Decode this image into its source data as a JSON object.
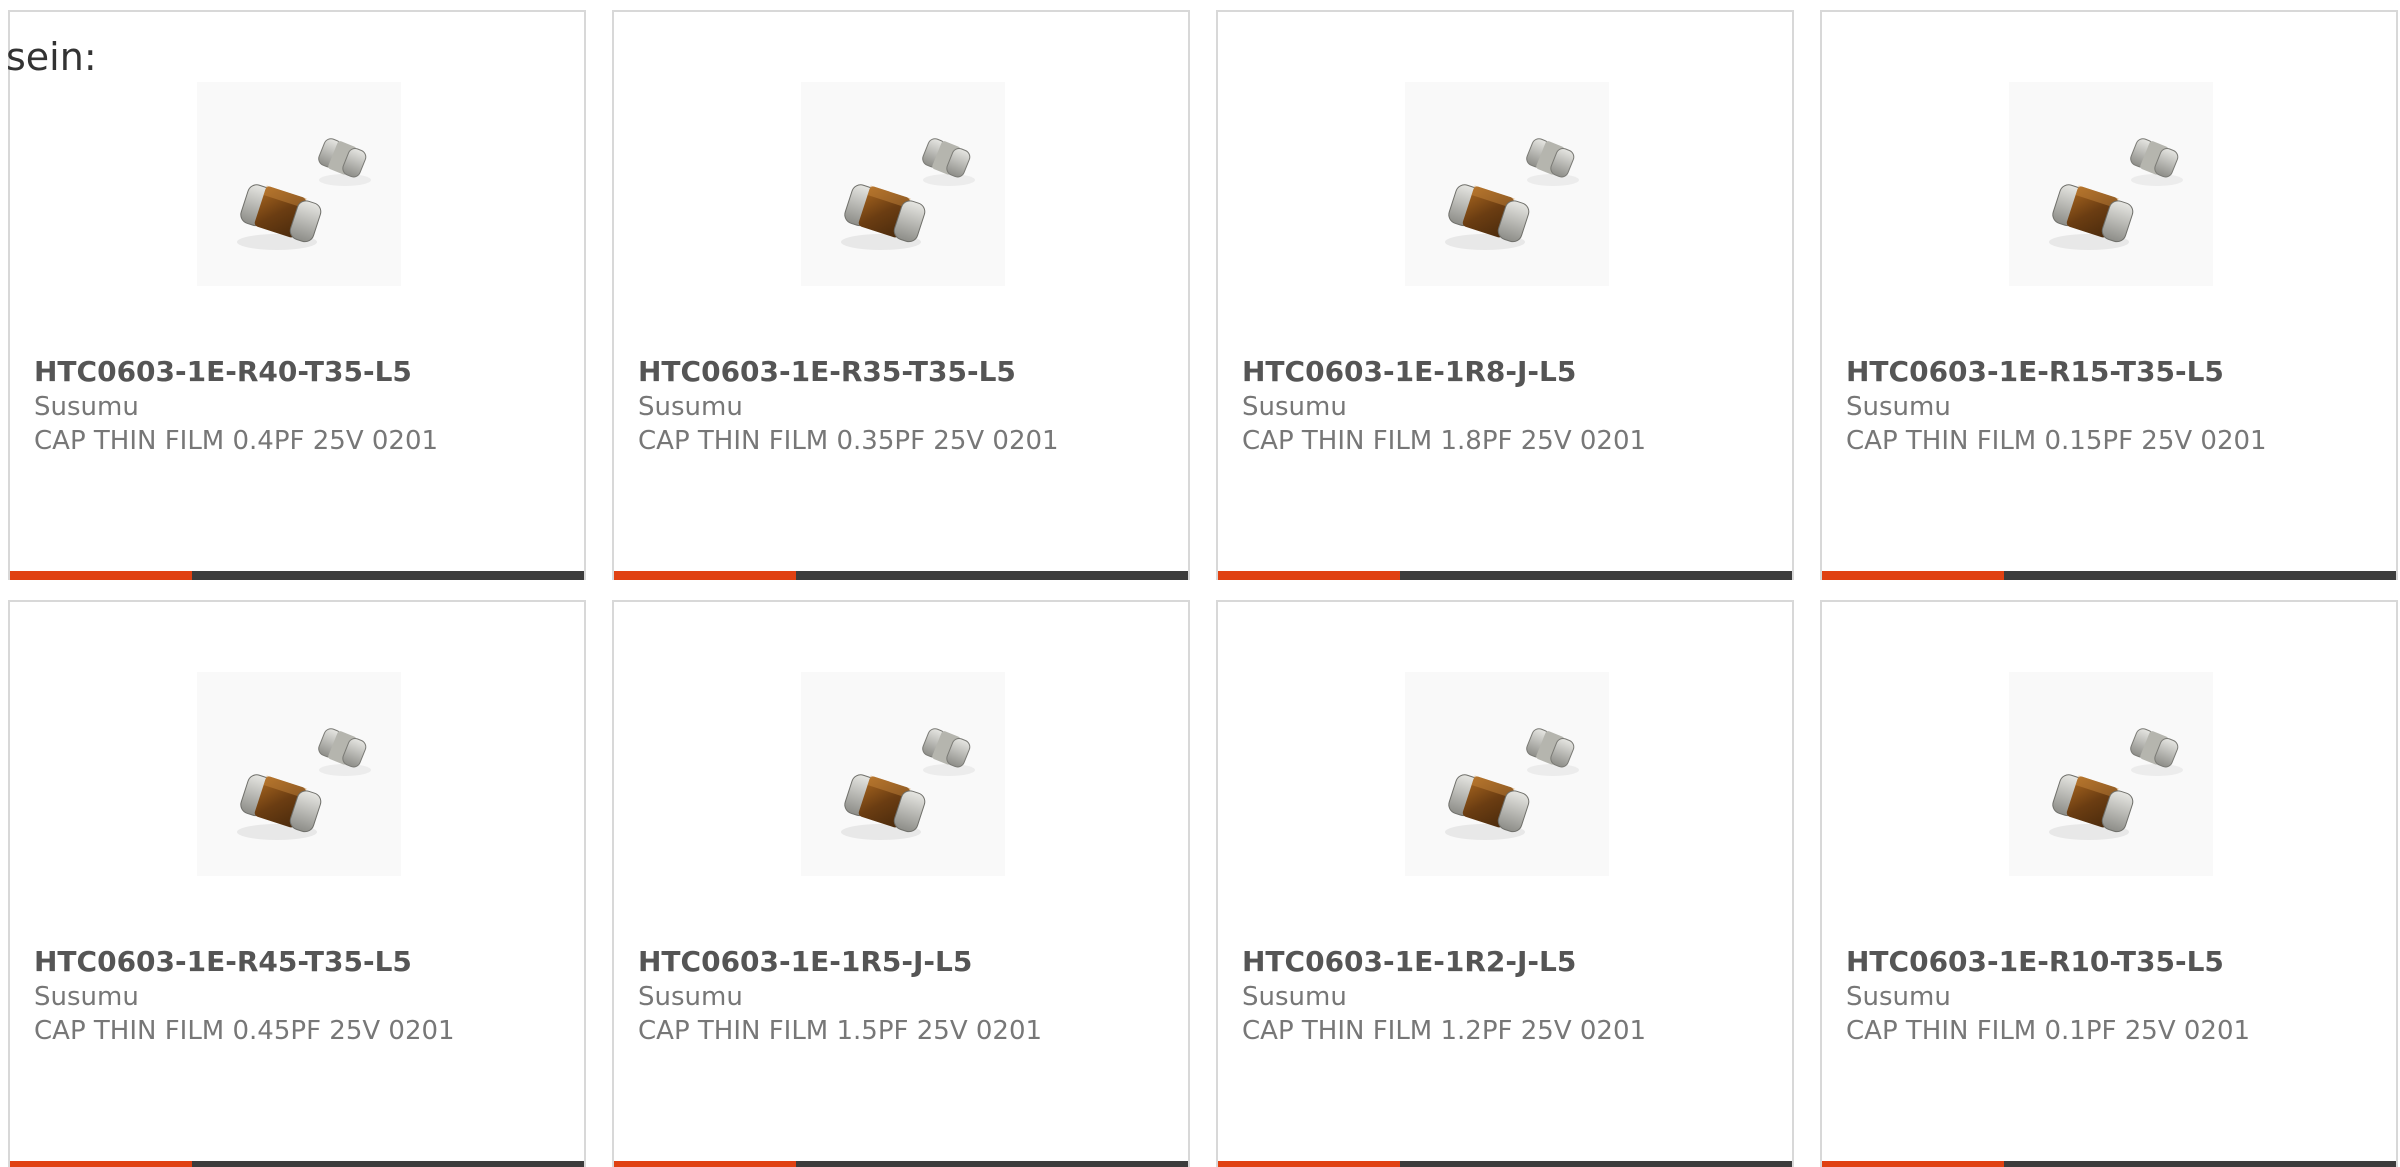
{
  "heading": "sein:",
  "accent_color": "#e04112",
  "bar_color": "#3c3c3c",
  "products": [
    {
      "part_number": "HTC0603-1E-R40-T35-L5",
      "manufacturer": "Susumu",
      "description": "CAP THIN FILM 0.4PF 25V 0201",
      "image": "smd-capacitor-icon"
    },
    {
      "part_number": "HTC0603-1E-R35-T35-L5",
      "manufacturer": "Susumu",
      "description": "CAP THIN FILM 0.35PF 25V 0201",
      "image": "smd-capacitor-icon"
    },
    {
      "part_number": "HTC0603-1E-1R8-J-L5",
      "manufacturer": "Susumu",
      "description": "CAP THIN FILM 1.8PF 25V 0201",
      "image": "smd-capacitor-icon"
    },
    {
      "part_number": "HTC0603-1E-R15-T35-L5",
      "manufacturer": "Susumu",
      "description": "CAP THIN FILM 0.15PF 25V 0201",
      "image": "smd-capacitor-icon"
    },
    {
      "part_number": "HTC0603-1E-R45-T35-L5",
      "manufacturer": "Susumu",
      "description": "CAP THIN FILM 0.45PF 25V 0201",
      "image": "smd-capacitor-icon"
    },
    {
      "part_number": "HTC0603-1E-1R5-J-L5",
      "manufacturer": "Susumu",
      "description": "CAP THIN FILM 1.5PF 25V 0201",
      "image": "smd-capacitor-icon"
    },
    {
      "part_number": "HTC0603-1E-1R2-J-L5",
      "manufacturer": "Susumu",
      "description": "CAP THIN FILM 1.2PF 25V 0201",
      "image": "smd-capacitor-icon"
    },
    {
      "part_number": "HTC0603-1E-R10-T35-L5",
      "manufacturer": "Susumu",
      "description": "CAP THIN FILM 0.1PF 25V 0201",
      "image": "smd-capacitor-icon"
    }
  ]
}
